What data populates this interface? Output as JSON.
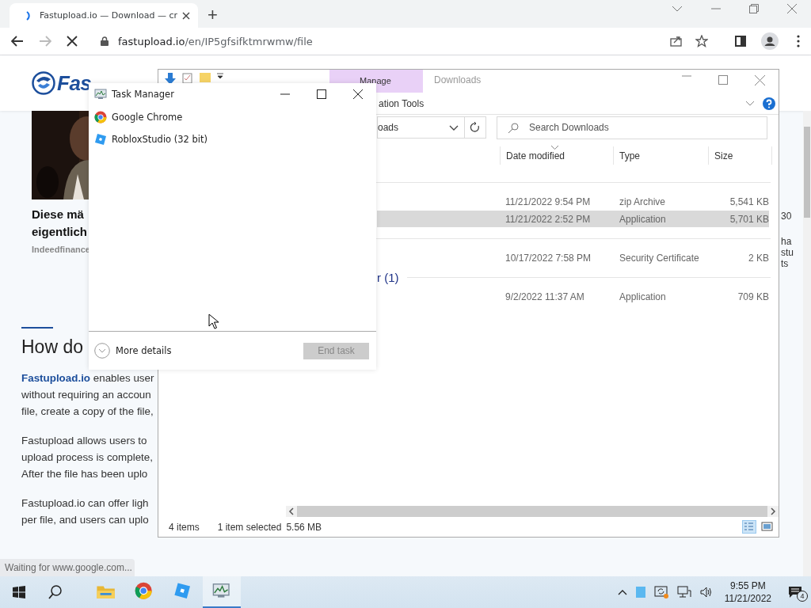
{
  "browser": {
    "tab": {
      "title": "Fastupload.io — Download — cr",
      "selected": true,
      "loading": true
    },
    "new_tab": "+",
    "address": {
      "host": "fastupload.io",
      "path": "/en/IP5gfsifktmrwmw/file"
    },
    "loading": true,
    "status": "Waiting for www.google.com..."
  },
  "page": {
    "logo": "Fas",
    "ad": {
      "kind": "picture",
      "headline": [
        "Diese mä",
        "eigentlich"
      ],
      "source": "Indeedfinance"
    },
    "heading": "How do",
    "paragraphs": [
      {
        "link": "Fastupload.io",
        "lines": [
          " enables user",
          "without requiring an accoun",
          "file, create a copy of the file,"
        ]
      },
      {
        "lines": [
          "Fastupload allows users to",
          "upload process is complete,",
          "After the file has been uplo"
        ]
      },
      {
        "lines": [
          "Fastupload.io can offer ligh",
          "per file, and users can uplo"
        ]
      }
    ],
    "right_fragments": [
      "30",
      "ha",
      "stu",
      "ts"
    ]
  },
  "explorer": {
    "title": "Downloads",
    "ribbon_tab": {
      "label": "Manage",
      "selected": true
    },
    "ribbon_group": "ation Tools",
    "breadcrumb": "oads",
    "search": {
      "placeholder": "Search Downloads"
    },
    "columns": [
      {
        "label": "Date modified",
        "sorted": true
      },
      {
        "label": "Type",
        "sorted": false
      },
      {
        "label": "Size",
        "sorted": false
      }
    ],
    "groups": [
      {
        "rows": [
          {
            "date": "11/21/2022 9:54 PM",
            "type": "zip Archive",
            "size": "5,541 KB",
            "selected": false
          },
          {
            "date": "11/21/2022 2:52 PM",
            "type": "Application",
            "size": "5,701 KB",
            "selected": true
          }
        ]
      },
      {
        "rows": [
          {
            "date": "10/17/2022 7:58 PM",
            "type": "Security Certificate",
            "size": "2 KB",
            "selected": false
          }
        ]
      },
      {
        "label": "r (1)",
        "rows": [
          {
            "date": "9/2/2022 11:37 AM",
            "type": "Application",
            "size": "709 KB",
            "selected": false
          }
        ]
      }
    ],
    "status": {
      "count": "4 items",
      "selection": "1 item selected",
      "size": "5.56 MB"
    },
    "views": [
      {
        "kind": "details",
        "selected": true
      },
      {
        "kind": "tiles",
        "selected": false
      }
    ]
  },
  "task_manager": {
    "title": "Task Manager",
    "apps": [
      {
        "kind": "chrome",
        "name": "Google Chrome"
      },
      {
        "kind": "roblox",
        "name": "RobloxStudio (32 bit)"
      }
    ],
    "more_details": "More details",
    "end_task": {
      "label": "End task",
      "disabled": true
    }
  },
  "taskbar": {
    "apps": [
      {
        "kind": "explorer",
        "active": false
      },
      {
        "kind": "chrome",
        "active": false
      },
      {
        "kind": "roblox",
        "active": false
      },
      {
        "kind": "taskmgr",
        "active": true
      }
    ],
    "time": "9:55 PM",
    "date": "11/21/2022",
    "notifications": "4"
  }
}
